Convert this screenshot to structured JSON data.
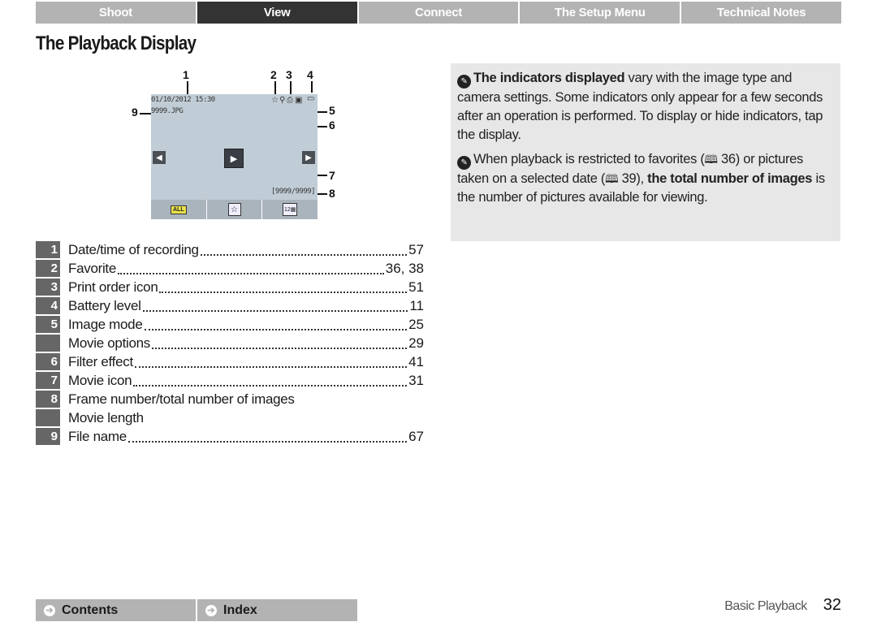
{
  "tabs": [
    {
      "label": "Shoot",
      "active": false
    },
    {
      "label": "View",
      "active": true
    },
    {
      "label": "Connect",
      "active": false
    },
    {
      "label": "The Setup Menu",
      "active": false
    },
    {
      "label": "Technical Notes",
      "active": false
    }
  ],
  "title": "The Playback Display",
  "diagram": {
    "datetime": "01/10/2012  15:30",
    "filename": "9999.JPG",
    "frame_counter": "[9999/9999]",
    "callouts": [
      "1",
      "2",
      "3",
      "4",
      "5",
      "6",
      "7",
      "8",
      "9"
    ],
    "prev_icon": "◀",
    "next_icon": "▶",
    "play_icon": "▶",
    "bottom_bar": {
      "all_label": "ALL",
      "favorite_icon": "☆",
      "date_icon": "12▦"
    },
    "status_icons": {
      "favorite": "☆",
      "filter": "⚲",
      "print": "⎙",
      "image_mode": "▣",
      "battery": "▭"
    }
  },
  "legend": [
    {
      "num": "1",
      "label": "Date/time of recording",
      "page": "57"
    },
    {
      "num": "2",
      "label": "Favorite",
      "page": "36, 38"
    },
    {
      "num": "3",
      "label": "Print order icon",
      "page": "51"
    },
    {
      "num": "4",
      "label": "Battery level",
      "page": "11"
    },
    {
      "num": "5",
      "label": "Image mode",
      "page": "25"
    },
    {
      "num": "",
      "label": "Movie options",
      "page": "29"
    },
    {
      "num": "6",
      "label": "Filter effect",
      "page": "41"
    },
    {
      "num": "7",
      "label": "Movie icon",
      "page": "31"
    },
    {
      "num": "8",
      "label": "Frame number/total number of images",
      "page": ""
    },
    {
      "num": "",
      "label": "Movie length",
      "page": ""
    },
    {
      "num": "9",
      "label": "File name",
      "page": "67"
    }
  ],
  "notes": {
    "note1": {
      "bold": "The indicators displayed",
      "text": " vary with the image type and camera settings. Some indicators only appear for a few seconds after an operation is performed. To display or hide indicators, tap the display."
    },
    "note2": {
      "text_a": "When playback is restricted to favorites (",
      "ref_a": " 36) or pictures taken on a selected date (",
      "ref_b": " 39), ",
      "bold": "the total number of images",
      "text_b": " is the number of pictures available for viewing."
    }
  },
  "footer": {
    "contents_label": "Contents",
    "index_label": "Index",
    "section": "Basic Playback",
    "page": "32"
  }
}
